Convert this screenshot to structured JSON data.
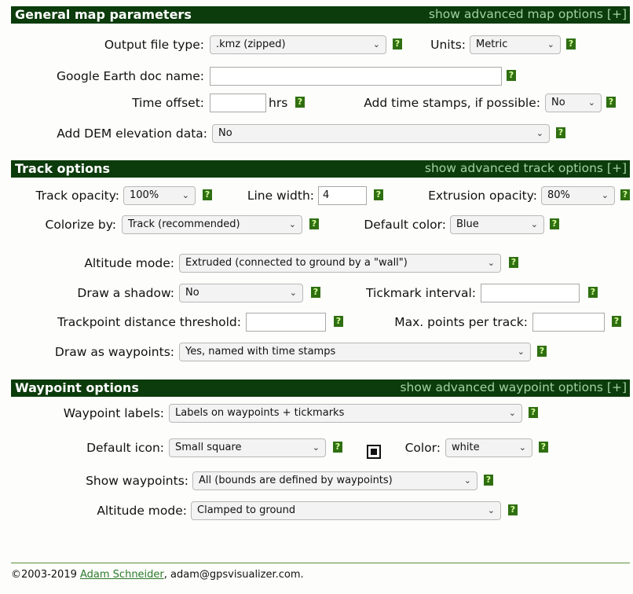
{
  "general": {
    "title": "General map parameters",
    "advanced_link": "show advanced map options [+]",
    "output_file_type_label": "Output file type:",
    "output_file_type_value": ".kmz (zipped)",
    "units_label": "Units:",
    "units_value": "Metric",
    "doc_name_label": "Google Earth doc name:",
    "doc_name_value": "",
    "time_offset_label": "Time offset:",
    "time_offset_value": "",
    "hrs_label": "hrs",
    "add_timestamps_label": "Add time stamps, if possible:",
    "add_timestamps_value": "No",
    "dem_label": "Add DEM elevation data:",
    "dem_value": "No"
  },
  "track": {
    "title": "Track options",
    "advanced_link": "show advanced track options [+]",
    "opacity_label": "Track opacity:",
    "opacity_value": "100%",
    "line_width_label": "Line width:",
    "line_width_value": "4",
    "extrusion_label": "Extrusion opacity:",
    "extrusion_value": "80%",
    "colorize_label": "Colorize by:",
    "colorize_value": "Track (recommended)",
    "default_color_label": "Default color:",
    "default_color_value": "Blue",
    "altitude_label": "Altitude mode:",
    "altitude_value": "Extruded (connected to ground by a \"wall\")",
    "shadow_label": "Draw a shadow:",
    "shadow_value": "No",
    "tickmark_label": "Tickmark interval:",
    "tickmark_value": "",
    "threshold_label": "Trackpoint distance threshold:",
    "threshold_value": "",
    "maxpoints_label": "Max. points per track:",
    "maxpoints_value": "",
    "waypoints_label": "Draw as waypoints:",
    "waypoints_value": "Yes, named with time stamps"
  },
  "waypoint": {
    "title": "Waypoint options",
    "advanced_link": "show advanced waypoint options [+]",
    "labels_label": "Waypoint labels:",
    "labels_value": "Labels on waypoints + tickmarks",
    "icon_label": "Default icon:",
    "icon_value": "Small square",
    "color_label": "Color:",
    "color_value": "white",
    "show_label": "Show waypoints:",
    "show_value": "All (bounds are defined by waypoints)",
    "altitude_label": "Altitude mode:",
    "altitude_value": "Clamped to ground"
  },
  "help_glyph": "?",
  "chevron_glyph": "⌄",
  "footer": {
    "prefix": "©2003-2019 ",
    "author": "Adam Schneider",
    "suffix": ", adam@gpsvisualizer.com."
  }
}
